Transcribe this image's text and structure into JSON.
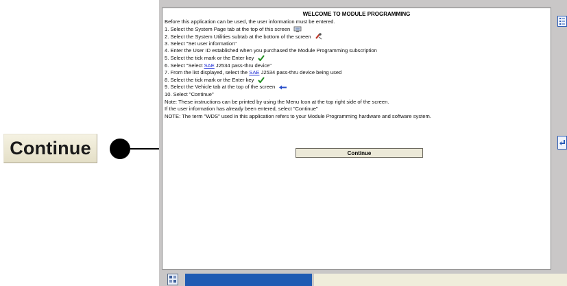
{
  "callout": {
    "button_label": "Continue"
  },
  "dialog": {
    "title": "WELCOME TO MODULE PROGRAMMING",
    "lines": {
      "l0": "Before this application can be used, the user information must be entered.",
      "l1": "1. Select the System Page tab at the top of this screen",
      "l2": "2. Select the System Utilities subtab at the bottom of the screen",
      "l3": "3. Select \"Set user information\"",
      "l4": "4. Enter the User ID established when you purchased the Module Programming subscription",
      "l5": "5. Select the tick mark or the Enter key",
      "l6_pre": "6. Select \"Select ",
      "l6_link": "SAE",
      "l6_post": " J2534 pass-thru device\"",
      "l7_pre": "7. From the list displayed, select the ",
      "l7_link": "SAE",
      "l7_post": " J2534 pass-thru device being used",
      "l8": "8. Select the tick mark or the Enter key",
      "l9": "9. Select the Vehicle tab at the top of the screen",
      "l10": "10. Select \"Continue\"",
      "l11": "Note: These instructions can be printed by using the Menu Icon at the top right side of the screen.",
      "l12": "If the user information has already been entered, select \"Continue\"",
      "l13": "NOTE: The term \"WDS\" used in this application refers to your Module Programming hardware and software system."
    },
    "continue_label": "Continue"
  },
  "icons": {
    "system_page": "system-page-icon",
    "utilities": "system-utilities-icon",
    "tick": "tick-icon",
    "vehicle": "vehicle-tab-arrow-icon",
    "menu": "menu-icon",
    "return": "return-icon"
  },
  "colors": {
    "link": "#1f2fd6",
    "tick": "#1e8c1e",
    "taskbar_blue": "#1f5bb3",
    "button_face": "#ece9d8"
  }
}
